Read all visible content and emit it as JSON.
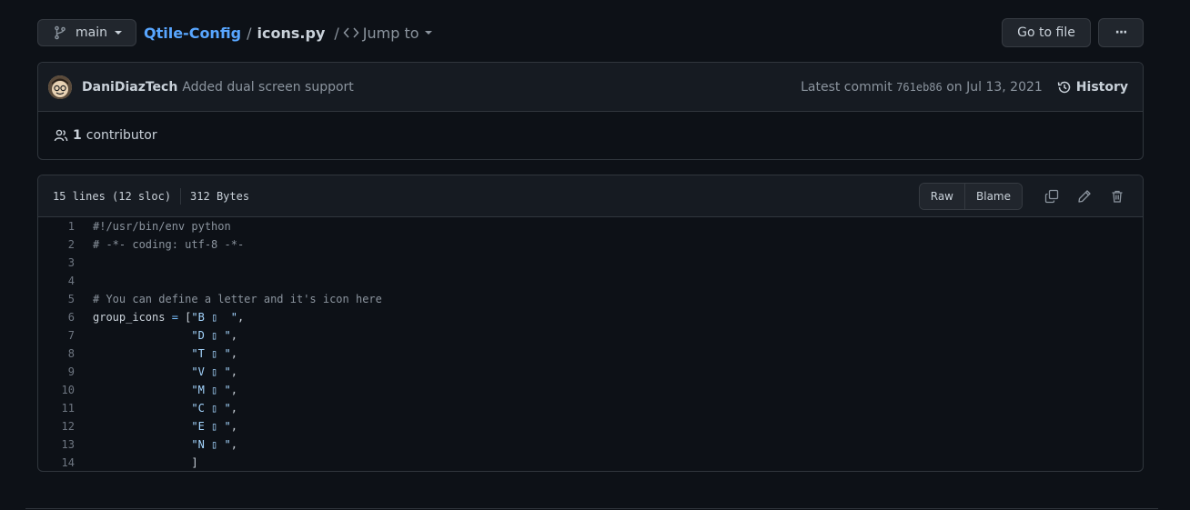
{
  "topbar": {
    "branch": "main",
    "repo": "Qtile-Config",
    "separator": "/",
    "file": "icons.py",
    "jump_label": "Jump to",
    "goto_label": "Go to file",
    "more_label": "···"
  },
  "commit": {
    "author": "DaniDiazTech",
    "message": "Added dual screen support",
    "latest_prefix": "Latest commit",
    "sha": "761eb86",
    "date": "on Jul 13, 2021",
    "history_label": "History",
    "contributors_count": "1",
    "contributors_label": "contributor"
  },
  "file": {
    "lines_info": "15 lines (12 sloc)",
    "size": "312 Bytes",
    "raw_label": "Raw",
    "blame_label": "Blame"
  },
  "code": [
    {
      "n": "1",
      "segments": [
        {
          "t": "#!/usr/bin/env python",
          "c": "comment"
        }
      ]
    },
    {
      "n": "2",
      "segments": [
        {
          "t": "# -*- coding: utf-8 -*-",
          "c": "comment"
        }
      ]
    },
    {
      "n": "3",
      "segments": []
    },
    {
      "n": "4",
      "segments": []
    },
    {
      "n": "5",
      "segments": [
        {
          "t": "# You can define a letter and it's icon here",
          "c": "comment"
        }
      ]
    },
    {
      "n": "6",
      "segments": [
        {
          "t": "group_icons ",
          "c": ""
        },
        {
          "t": "=",
          "c": "op"
        },
        {
          "t": " [",
          "c": ""
        },
        {
          "t": "\"B ▯  \"",
          "c": "str"
        },
        {
          "t": ",",
          "c": ""
        }
      ]
    },
    {
      "n": "7",
      "segments": [
        {
          "t": "               ",
          "c": ""
        },
        {
          "t": "\"D ▯ \"",
          "c": "str"
        },
        {
          "t": ",",
          "c": ""
        }
      ]
    },
    {
      "n": "8",
      "segments": [
        {
          "t": "               ",
          "c": ""
        },
        {
          "t": "\"T ▯ \"",
          "c": "str"
        },
        {
          "t": ",",
          "c": ""
        }
      ]
    },
    {
      "n": "9",
      "segments": [
        {
          "t": "               ",
          "c": ""
        },
        {
          "t": "\"V ▯ \"",
          "c": "str"
        },
        {
          "t": ",",
          "c": ""
        }
      ]
    },
    {
      "n": "10",
      "segments": [
        {
          "t": "               ",
          "c": ""
        },
        {
          "t": "\"M ▯ \"",
          "c": "str"
        },
        {
          "t": ",",
          "c": ""
        }
      ]
    },
    {
      "n": "11",
      "segments": [
        {
          "t": "               ",
          "c": ""
        },
        {
          "t": "\"C ▯ \"",
          "c": "str"
        },
        {
          "t": ",",
          "c": ""
        }
      ]
    },
    {
      "n": "12",
      "segments": [
        {
          "t": "               ",
          "c": ""
        },
        {
          "t": "\"E ▯ \"",
          "c": "str"
        },
        {
          "t": ",",
          "c": ""
        }
      ]
    },
    {
      "n": "13",
      "segments": [
        {
          "t": "               ",
          "c": ""
        },
        {
          "t": "\"N ▯ \"",
          "c": "str"
        },
        {
          "t": ",",
          "c": ""
        }
      ]
    },
    {
      "n": "14",
      "segments": [
        {
          "t": "               ]",
          "c": ""
        }
      ]
    }
  ],
  "icons": {
    "branch": "git-branch-icon",
    "code": "code-icon",
    "history": "history-icon",
    "people": "people-icon",
    "copy": "copy-icon",
    "edit": "pencil-icon",
    "delete": "trash-icon"
  },
  "colors": {
    "background": "#0d1117",
    "link": "#58a6ff",
    "muted": "#8b949e",
    "border": "#30363d"
  }
}
